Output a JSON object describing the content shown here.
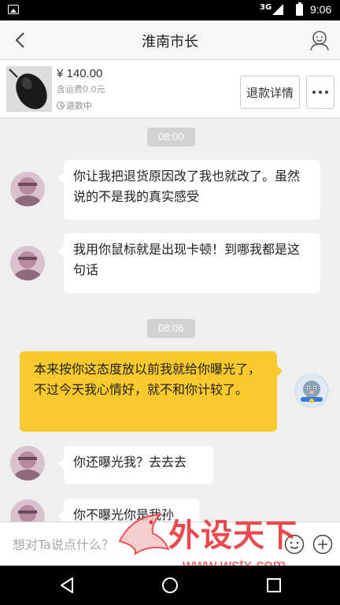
{
  "status_bar": {
    "network": "3G",
    "time": "9:06",
    "icons": [
      "picture-icon",
      "signal-icon",
      "battery-icon"
    ]
  },
  "header": {
    "title": "淮南市长",
    "back_icon": "chevron-left-icon",
    "profile_icon": "user-profile-icon"
  },
  "order": {
    "price": "¥ 140.00",
    "shipping_note": "含运费0.0元",
    "status": "退款中",
    "refund_button_label": "退款详情",
    "more_icon": "more-dots-icon"
  },
  "messages": [
    {
      "type": "time",
      "text": "08:00"
    },
    {
      "type": "text",
      "from": "other",
      "text": "你让我把退货原因改了我也就改了。虽然说的不是我的真实感受"
    },
    {
      "type": "text",
      "from": "other",
      "text": "我用你鼠标就是出现卡顿！到哪我都是这句话"
    },
    {
      "type": "time",
      "text": "08:06"
    },
    {
      "type": "text",
      "from": "me",
      "text": "本来按你这态度放以前我就给你曝光了，不过今天我心情好，就不和你计较了。"
    },
    {
      "type": "text",
      "from": "other",
      "text": "你还曝光我？去去去"
    },
    {
      "type": "text",
      "from": "other",
      "text": "你不曝光你是我孙"
    }
  ],
  "input": {
    "placeholder": "想对Ta说点什么？",
    "emoji_icon": "emoji-icon",
    "add_icon": "plus-circle-icon"
  },
  "watermark": {
    "text": "外设天下",
    "url": "www.wstx.com"
  },
  "nav_bar": {
    "icons": [
      "back-triangle-icon",
      "home-circle-icon",
      "recents-square-icon"
    ]
  },
  "colors": {
    "my_bubble": "#f9c92d",
    "other_bubble": "#ffffff",
    "chat_background": "#efefef",
    "watermark": "#e8363b"
  }
}
